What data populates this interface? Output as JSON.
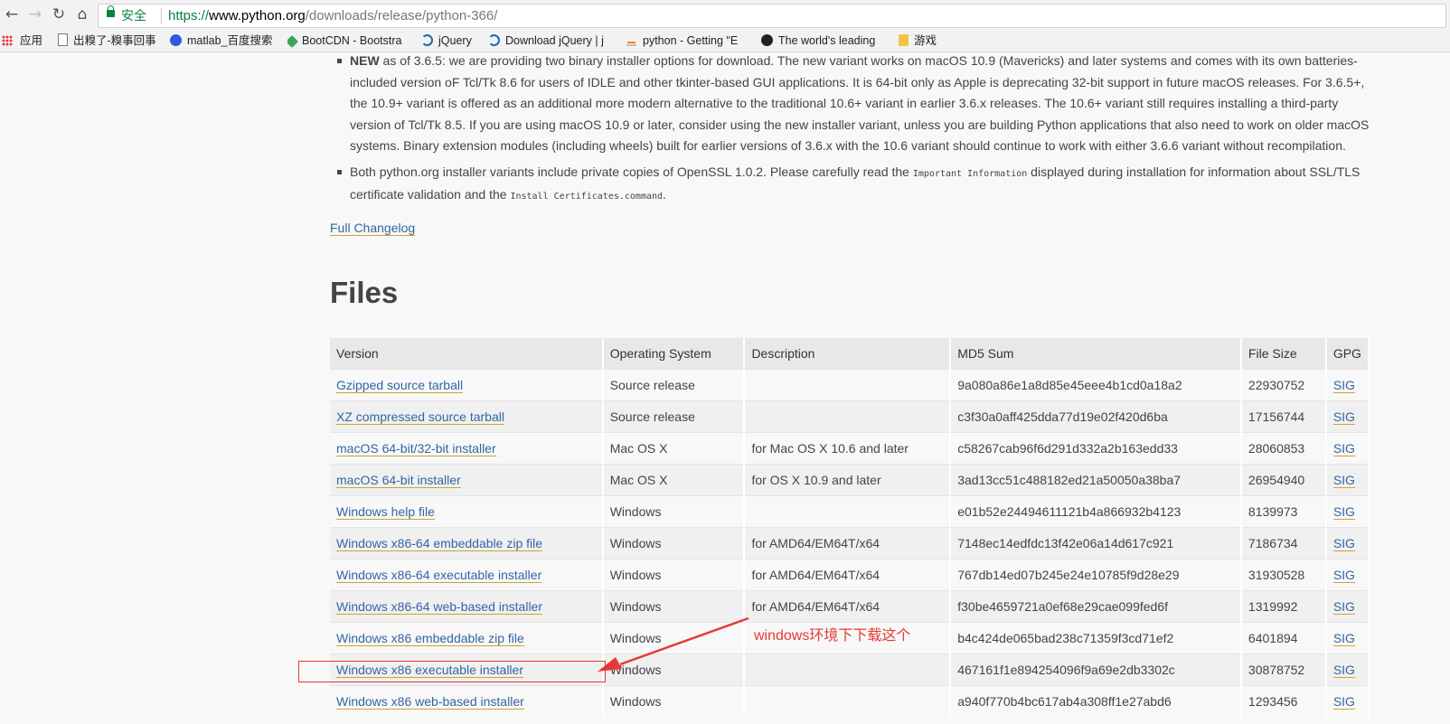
{
  "browser": {
    "secure_label": "安全",
    "url_scheme": "https://",
    "url_host": "www.python.org",
    "url_path": "/downloads/release/python-366/",
    "bookmarks": [
      {
        "label": "应用",
        "icon": "apps-grid-icon"
      },
      {
        "label": "出糗了-糗事回事",
        "icon": "page-icon"
      },
      {
        "label": "matlab_百度搜索",
        "icon": "baidu-paw-icon"
      },
      {
        "label": "BootCDN - Bootstra",
        "icon": "bootcdn-icon"
      },
      {
        "label": "jQuery",
        "icon": "jquery-icon"
      },
      {
        "label": "Download jQuery | j",
        "icon": "jquery-icon"
      },
      {
        "label": "python - Getting \"E",
        "icon": "stackoverflow-icon"
      },
      {
        "label": "The world's leading",
        "icon": "github-icon"
      },
      {
        "label": "游戏",
        "icon": "folder-icon"
      }
    ]
  },
  "notes": {
    "new_label": "NEW",
    "new_text": " as of 3.6.5: we are providing two binary installer options for download. The new variant works on macOS 10.9 (Mavericks) and later systems and comes with its own batteries-included version oF Tcl/Tk 8.6 for users of IDLE and other tkinter-based GUI applications. It is 64-bit only as Apple is deprecating 32-bit support in future macOS releases. For 3.6.5+, the 10.9+ variant is offered as an additional more modern alternative to the traditional 10.6+ variant in earlier 3.6.x releases. The 10.6+ variant still requires installing a third-party version of Tcl/Tk 8.5. If you are using macOS 10.9 or later, consider using the new installer variant, unless you are building Python applications that also need to work on older macOS systems. Binary extension modules (including wheels) built for earlier versions of 3.6.x with the 10.6 variant should continue to work with either 3.6.6 variant without recompilation.",
    "openssl_text_1": "Both python.org installer variants include private copies of OpenSSL 1.0.2. Please carefully read the ",
    "openssl_code_1": "Important Information",
    "openssl_text_2": " displayed during installation for information about SSL/TLS certificate validation and the ",
    "openssl_code_2": "Install Certificates.command",
    "openssl_text_3": "."
  },
  "changelog_label": "Full Changelog",
  "files_heading": "Files",
  "table": {
    "headers": [
      "Version",
      "Operating System",
      "Description",
      "MD5 Sum",
      "File Size",
      "GPG"
    ],
    "rows": [
      {
        "version": "Gzipped source tarball",
        "os": "Source release",
        "desc": "",
        "md5": "9a080a86e1a8d85e45eee4b1cd0a18a2",
        "size": "22930752",
        "gpg": "SIG"
      },
      {
        "version": "XZ compressed source tarball",
        "os": "Source release",
        "desc": "",
        "md5": "c3f30a0aff425dda77d19e02f420d6ba",
        "size": "17156744",
        "gpg": "SIG"
      },
      {
        "version": "macOS 64-bit/32-bit installer",
        "os": "Mac OS X",
        "desc": "for Mac OS X 10.6 and later",
        "md5": "c58267cab96f6d291d332a2b163edd33",
        "size": "28060853",
        "gpg": "SIG"
      },
      {
        "version": "macOS 64-bit installer",
        "os": "Mac OS X",
        "desc": "for OS X 10.9 and later",
        "md5": "3ad13cc51c488182ed21a50050a38ba7",
        "size": "26954940",
        "gpg": "SIG"
      },
      {
        "version": "Windows help file",
        "os": "Windows",
        "desc": "",
        "md5": "e01b52e24494611121b4a866932b4123",
        "size": "8139973",
        "gpg": "SIG"
      },
      {
        "version": "Windows x86-64 embeddable zip file",
        "os": "Windows",
        "desc": "for AMD64/EM64T/x64",
        "md5": "7148ec14edfdc13f42e06a14d617c921",
        "size": "7186734",
        "gpg": "SIG"
      },
      {
        "version": "Windows x86-64 executable installer",
        "os": "Windows",
        "desc": "for AMD64/EM64T/x64",
        "md5": "767db14ed07b245e24e10785f9d28e29",
        "size": "31930528",
        "gpg": "SIG"
      },
      {
        "version": "Windows x86-64 web-based installer",
        "os": "Windows",
        "desc": "for AMD64/EM64T/x64",
        "md5": "f30be4659721a0ef68e29cae099fed6f",
        "size": "1319992",
        "gpg": "SIG"
      },
      {
        "version": "Windows x86 embeddable zip file",
        "os": "Windows",
        "desc": "",
        "md5": "b4c424de065bad238c71359f3cd71ef2",
        "size": "6401894",
        "gpg": "SIG"
      },
      {
        "version": "Windows x86 executable installer",
        "os": "Windows",
        "desc": "",
        "md5": "467161f1e894254096f9a69e2db3302c",
        "size": "30878752",
        "gpg": "SIG"
      },
      {
        "version": "Windows x86 web-based installer",
        "os": "Windows",
        "desc": "",
        "md5": "a940f770b4bc617ab4a308ff1e27abd6",
        "size": "1293456",
        "gpg": "SIG"
      }
    ]
  },
  "annotation": {
    "text": "windows环境下下载这个",
    "color": "#e53935"
  },
  "colors": {
    "link": "#3465a4",
    "link_underline": "#c7a82b",
    "secure_green": "#0b8043"
  }
}
